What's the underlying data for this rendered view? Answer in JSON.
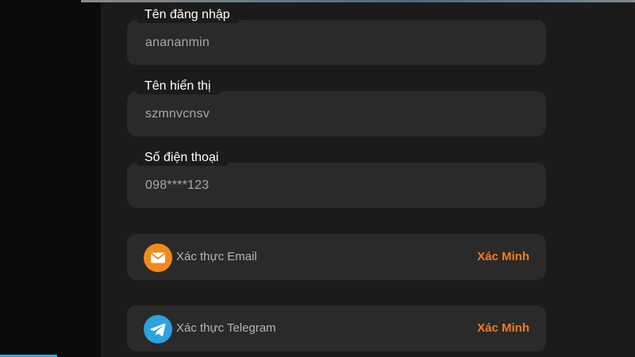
{
  "fields": [
    {
      "label": "Tên đăng nhập",
      "value": "anananmin"
    },
    {
      "label": "Tên hiển thị",
      "value": "szmnvcnsv"
    },
    {
      "label": "Số điện thoại",
      "value": "098****123"
    }
  ],
  "verifications": [
    {
      "label": "Xác thực Email",
      "action": "Xác Minh",
      "icon": "email-icon"
    },
    {
      "label": "Xác thực Telegram",
      "action": "Xác Minh",
      "icon": "telegram-icon"
    }
  ],
  "colors": {
    "accent": "#f47a20",
    "email_icon_bg": "#f28a1c",
    "telegram_icon_bg": "#2aa3de",
    "field_bg": "#2a2a2a",
    "panel_bg": "#1b1b1b"
  }
}
